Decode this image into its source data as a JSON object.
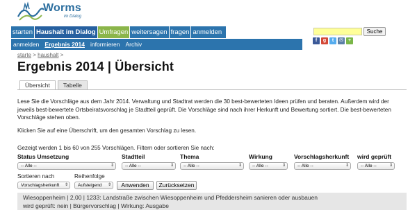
{
  "logo": {
    "name": "Worms",
    "tagline": "im Dialog"
  },
  "main_nav": [
    {
      "label": "starten"
    },
    {
      "label": "Haushalt im Dialog"
    },
    {
      "label": "Umfragen"
    },
    {
      "label": "weitersagen"
    },
    {
      "label": "fragen"
    },
    {
      "label": "anmelden"
    }
  ],
  "search": {
    "value": "",
    "button_label": "Suche"
  },
  "social_icons": [
    "facebook-icon",
    "google-plus-icon",
    "twitter-icon",
    "email-icon",
    "share-icon"
  ],
  "sub_nav": [
    {
      "label": "anmelden"
    },
    {
      "label": "Ergebnis 2014"
    },
    {
      "label": "informieren"
    },
    {
      "label": "Archiv"
    }
  ],
  "breadcrumb": {
    "home": "starte",
    "separator": ">",
    "section": "haushalt",
    "trail": ">"
  },
  "page_title": "Ergebnis 2014 | Übersicht",
  "view_tabs": [
    {
      "label": "Übersicht"
    },
    {
      "label": "Tabelle"
    }
  ],
  "intro_text": "Lese Sie die Vorschläge aus dem Jahr 2014. Verwaltung und Stadtrat werden die 30 best-bewerteten Ideen prüfen und beraten. Außerdem wird der jeweils best-bewertete Ortsbeiratsvorschlag je Stadtteil geprüft. Die Vorschläge sind nach ihrer Herkunft und Bewertung sortiert. Die best-bewerteten Vorschläge stehen oben.",
  "hint_text": "Klicken Sie auf eine Überschrift, um den gesamten Vorschlag zu lesen.",
  "count_text": "Gezeigt werden 1 bis 60 von 255 Vorschlägen. Filtern oder sortieren Sie nach:",
  "filters": {
    "status": {
      "label": "Status Umsetzung",
      "value": "-- Alle --"
    },
    "stadtteil": {
      "label": "Stadtteil",
      "value": "-- Alle --"
    },
    "thema": {
      "label": "Thema",
      "value": "-- Alle --"
    },
    "wirkung": {
      "label": "Wirkung",
      "value": "-- Alle --"
    },
    "herkunft": {
      "label": "Vorschlagsherkunft",
      "value": "-- Alle --"
    },
    "geprueft": {
      "label": "wird geprüft",
      "value": "-- Alle --"
    }
  },
  "sort": {
    "sort_label": "Sortieren nach",
    "sort_value": "Vorschlagsherkunft",
    "order_label": "Reihenfolge",
    "order_value": "Aufsteigend",
    "apply_label": "Anwenden",
    "reset_label": "Zurücksetzen"
  },
  "result_preview": {
    "line1": "Wiesoppenheim | 2,00 | 1233: Landstraße zwischen Wiesoppenheim und Pfeddersheim sanieren oder ausbauen",
    "line2": "wird geprüft: nein | Bürgervorschlag | Wirkung: Ausgabe"
  },
  "colors": {
    "nav_blue": "#2c74ad",
    "nav_green": "#8bb54a",
    "search_yellow": "#ffff99",
    "result_bg": "#e6e6e6"
  }
}
